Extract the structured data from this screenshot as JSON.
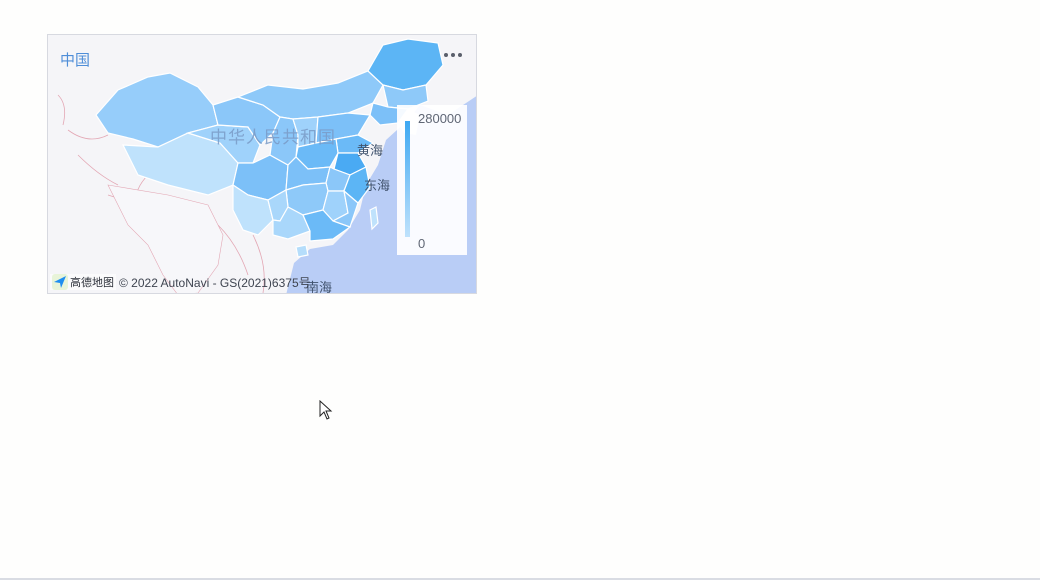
{
  "card": {
    "title": "中国"
  },
  "map": {
    "country_label": "中华人民共和国",
    "seas": {
      "yellow_sea": "黄海",
      "east_china_sea": "东海",
      "south_china_sea": "南海"
    },
    "legend": {
      "max": "280000",
      "min": "0"
    },
    "attribution": {
      "logo_text": "高德地图",
      "copyright": "© 2022 AutoNavi - GS(2021)6375号"
    },
    "colors": {
      "sea": "#b9cdf6",
      "land": "#f4f4f7",
      "low": "#bfe2fc",
      "high": "#3ea8f2",
      "accent": "#4f8ed8"
    }
  },
  "icons": {
    "more": "more-horizontal-icon",
    "logo": "amap-logo-icon"
  }
}
